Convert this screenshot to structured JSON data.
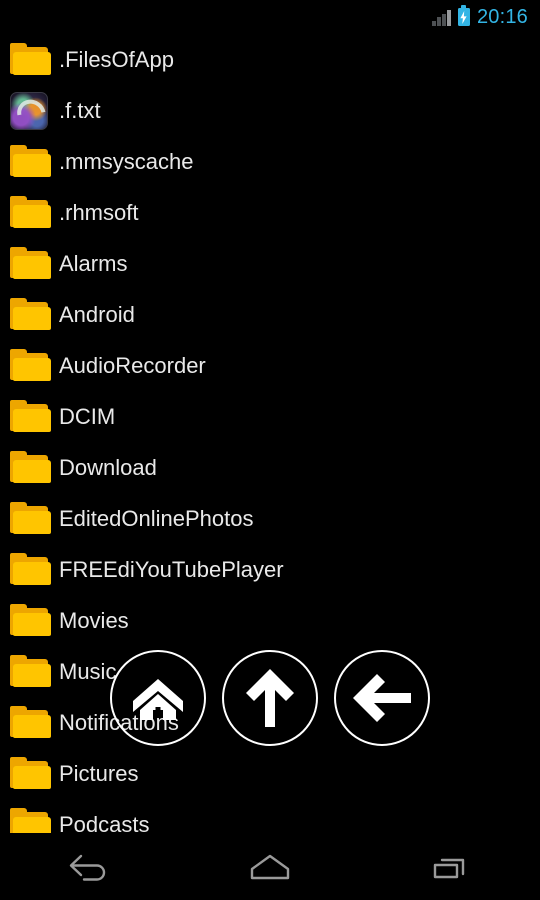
{
  "status_bar": {
    "clock": "20:16",
    "signal_icon": "signal-bars-icon",
    "battery_icon": "battery-charging-icon",
    "clock_color": "#33b5e5",
    "signal_color": "#97999c",
    "battery_color": "#33b5e5"
  },
  "file_list": {
    "background_color": "#000000",
    "text_color": "#e9e9e9",
    "folder_color": "#ffc500",
    "folder_shadow_color": "#eda600",
    "items": [
      {
        "name": ".FilesOfApp",
        "type": "folder",
        "icon": "folder-icon"
      },
      {
        "name": ".f.txt",
        "type": "file",
        "icon": "image-thumbnail-icon"
      },
      {
        "name": ".mmsyscache",
        "type": "folder",
        "icon": "folder-icon"
      },
      {
        "name": ".rhmsoft",
        "type": "folder",
        "icon": "folder-icon"
      },
      {
        "name": "Alarms",
        "type": "folder",
        "icon": "folder-icon"
      },
      {
        "name": "Android",
        "type": "folder",
        "icon": "folder-icon"
      },
      {
        "name": "AudioRecorder",
        "type": "folder",
        "icon": "folder-icon"
      },
      {
        "name": "DCIM",
        "type": "folder",
        "icon": "folder-icon"
      },
      {
        "name": "Download",
        "type": "folder",
        "icon": "folder-icon"
      },
      {
        "name": "EditedOnlinePhotos",
        "type": "folder",
        "icon": "folder-icon"
      },
      {
        "name": "FREEdiYouTubePlayer",
        "type": "folder",
        "icon": "folder-icon"
      },
      {
        "name": "Movies",
        "type": "folder",
        "icon": "folder-icon"
      },
      {
        "name": "Music",
        "type": "folder",
        "icon": "folder-icon"
      },
      {
        "name": "Notifications",
        "type": "folder",
        "icon": "folder-icon"
      },
      {
        "name": "Pictures",
        "type": "folder",
        "icon": "folder-icon"
      },
      {
        "name": "Podcasts",
        "type": "folder",
        "icon": "folder-icon"
      }
    ]
  },
  "floating_buttons": [
    {
      "name": "home",
      "icon": "home-icon",
      "label": "Home"
    },
    {
      "name": "up",
      "icon": "arrow-up-icon",
      "label": "Up"
    },
    {
      "name": "back",
      "icon": "arrow-left-icon",
      "label": "Back"
    }
  ],
  "nav_bar": {
    "color": "#9a9a9a",
    "buttons": [
      {
        "name": "back",
        "icon": "nav-back-icon",
        "label": "Back"
      },
      {
        "name": "home",
        "icon": "nav-home-icon",
        "label": "Home"
      },
      {
        "name": "recents",
        "icon": "nav-recents-icon",
        "label": "Recents"
      }
    ]
  }
}
